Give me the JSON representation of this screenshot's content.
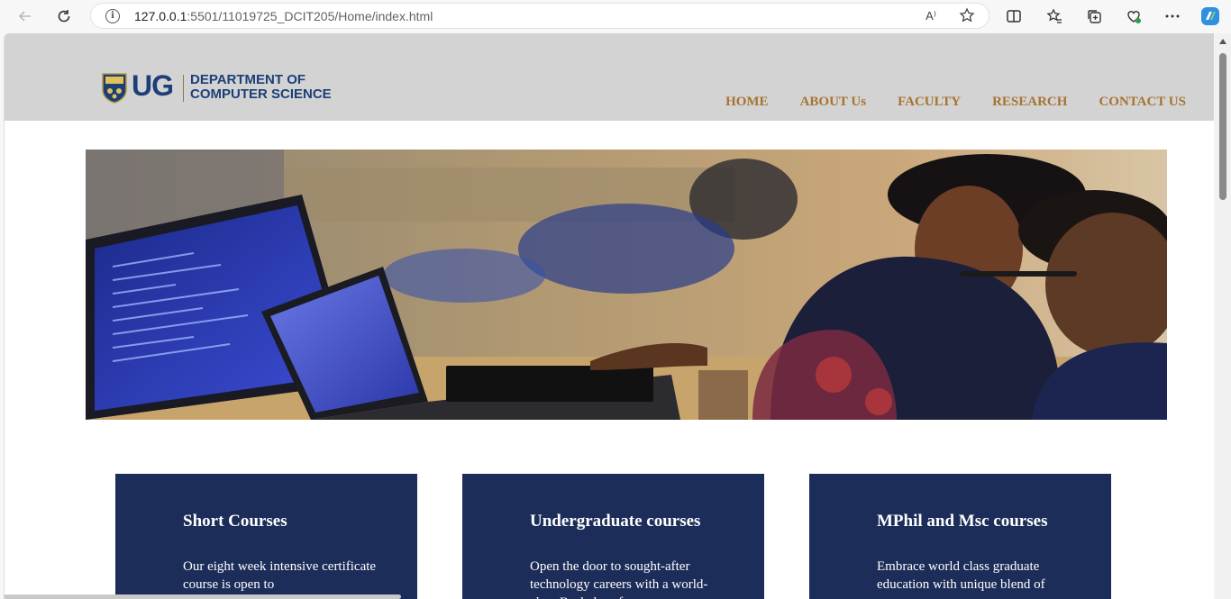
{
  "browser": {
    "url_host": "127.0.0.1",
    "url_path": ":5501/11019725_DCIT205/Home/index.html",
    "read_aloud_label": "A⁾",
    "icons": [
      "back-icon",
      "refresh-icon",
      "site-info-icon",
      "read-aloud-icon",
      "favorite-star-icon",
      "split-screen-icon",
      "favorites-icon",
      "collections-icon",
      "browser-essentials-icon",
      "more-icon",
      "copilot-icon"
    ]
  },
  "header": {
    "logo_ug": "UG",
    "logo_line1": "DEPARTMENT OF",
    "logo_line2": "COMPUTER SCIENCE",
    "nav": [
      "HOME",
      "ABOUT Us",
      "FACULTY",
      "RESEARCH",
      "CONTACT US"
    ]
  },
  "cards": [
    {
      "title": "Short Courses",
      "text": "Our eight week intensive certificate course is open to"
    },
    {
      "title": "Undergraduate courses",
      "text": "Open the door to sought-after technology careers with a world-class Bachelor of"
    },
    {
      "title": "MPhil and Msc courses",
      "text": "Embrace world class graduate education with unique blend of"
    }
  ],
  "colors": {
    "header_bg": "#d3d3d3",
    "nav_text": "#a77331",
    "card_bg": "#1c2d59",
    "brand_blue": "#1d3f77"
  }
}
